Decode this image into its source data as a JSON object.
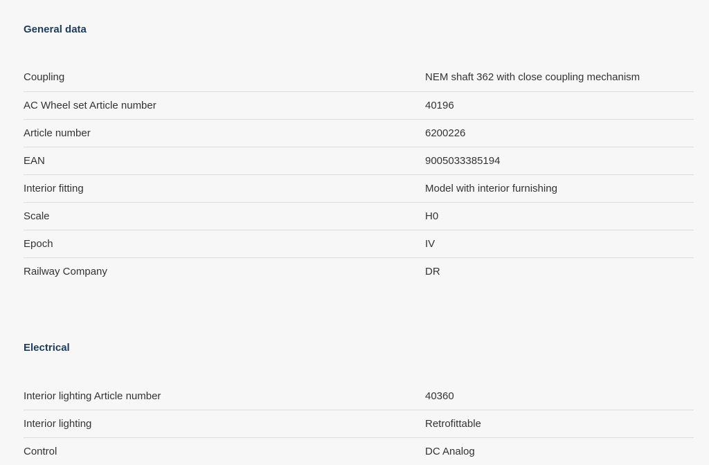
{
  "general": {
    "title": "General data",
    "rows": [
      {
        "label": "Coupling",
        "value": "NEM shaft 362 with close coupling mechanism"
      },
      {
        "label": "AC Wheel set Article number",
        "value": "40196"
      },
      {
        "label": "Article number",
        "value": "6200226"
      },
      {
        "label": "EAN",
        "value": "9005033385194"
      },
      {
        "label": "Interior fitting",
        "value": "Model with interior furnishing"
      },
      {
        "label": "Scale",
        "value": "H0"
      },
      {
        "label": "Epoch",
        "value": "IV"
      },
      {
        "label": "Railway Company",
        "value": "DR"
      }
    ]
  },
  "electrical": {
    "title": "Electrical",
    "rows": [
      {
        "label": "Interior lighting Article number",
        "value": "40360"
      },
      {
        "label": "Interior lighting",
        "value": "Retrofittable"
      },
      {
        "label": "Control",
        "value": "DC Analog"
      }
    ]
  }
}
